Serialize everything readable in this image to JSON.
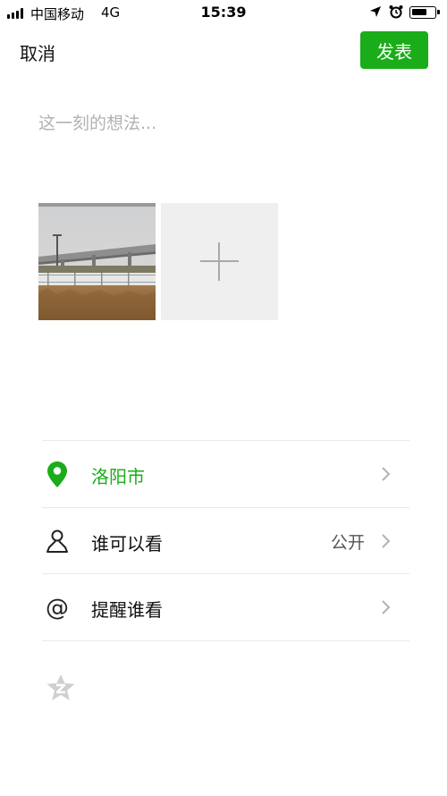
{
  "status_bar": {
    "carrier": "中国移动",
    "network": "4G",
    "time": "15:39",
    "icons": [
      "signal-bars-icon",
      "location-arrow-icon",
      "alarm-clock-icon",
      "battery-icon"
    ]
  },
  "nav": {
    "cancel_label": "取消",
    "publish_label": "发表"
  },
  "composer": {
    "placeholder": "这一刻的想法..."
  },
  "media": {
    "photos": [
      "photo-overpass-thumbnail"
    ],
    "add_icon": "plus-icon"
  },
  "options": [
    {
      "icon": "location-pin-icon",
      "label": "洛阳市",
      "value": ""
    },
    {
      "icon": "person-icon",
      "label": "谁可以看",
      "value": "公开"
    },
    {
      "icon": "at-sign-icon",
      "label": "提醒谁看",
      "value": ""
    }
  ],
  "footer": {
    "icon": "star-badge-icon"
  },
  "colors": {
    "accent": "#1aad19",
    "placeholder": "#b2b2b2",
    "divider": "#e9e9e9",
    "tile": "#efefef"
  }
}
